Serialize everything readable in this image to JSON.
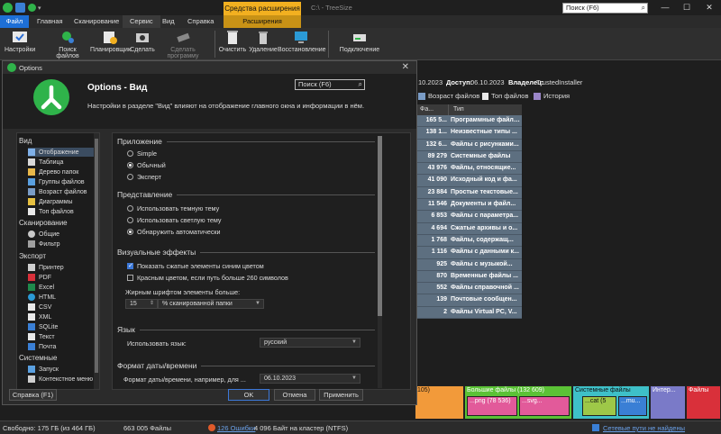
{
  "titlebar": {
    "context_tab": "Средства расширения",
    "title": "C:\\ - TreeSize",
    "search_placeholder": "Поиск (F6)",
    "minimize": "—",
    "maximize": "☐",
    "close": "✕"
  },
  "ribbon_tabs": [
    "Файл",
    "Главная",
    "Сканирование",
    "Сервис",
    "Вид",
    "Справка",
    "Расширения"
  ],
  "ribbon_buttons": [
    "Настройки",
    "Поиск файлов",
    "Планировщик",
    "Сделать",
    "Сделать программу",
    "Очистить",
    "Удаление",
    "Восстановление",
    "Подключение"
  ],
  "info": {
    "date": "10.2023",
    "access_label": "Доступ:",
    "access_value": "06.10.2023",
    "owner_label": "Владелец:",
    "owner_value": "TrustedInstaller"
  },
  "subtools": [
    "Возраст файлов",
    "Топ файлов",
    "История"
  ],
  "filetable": {
    "headers": [
      "Фа...",
      "Тип"
    ],
    "rows": [
      [
        "165 5...",
        "Программные файлы..."
      ],
      [
        "138 1...",
        "Неизвестные типы ..."
      ],
      [
        "132 6...",
        "Файлы с рисунками..."
      ],
      [
        "89 279",
        "Системные файлы"
      ],
      [
        "43 976",
        "Файлы, относящие..."
      ],
      [
        "41 090",
        "Исходный код и фа..."
      ],
      [
        "23 884",
        "Простые текстовые..."
      ],
      [
        "11 546",
        "Документы и файл..."
      ],
      [
        "6 853",
        "Файлы с параметра..."
      ],
      [
        "4 694",
        "Сжатые архивы и о..."
      ],
      [
        "1 768",
        "Файлы, содержащ..."
      ],
      [
        "1 116",
        "Файлы с данными к..."
      ],
      [
        "925",
        "Файлы с музыкой..."
      ],
      [
        "870",
        "Временные файлы ..."
      ],
      [
        "552",
        "Файлы справочной ..."
      ],
      [
        "139",
        "Почтовые сообщен..."
      ],
      [
        "2",
        "Файлы Virtual PC, V..."
      ]
    ]
  },
  "treemap": {
    "t1": "105)",
    "t2": "Большие файлы (132 609)",
    "t3": "...png (78 536)",
    "t4": "...svg...",
    "t5": "Системные файлы",
    "t6": "...cat (5",
    "t7": "...mu...",
    "t8": "Интер...",
    "t9": "Файлы"
  },
  "statusbar": {
    "free": "Свободно: 175 ГБ (из 464 ГБ)",
    "files": "663 005 Файлы",
    "errors": "126 Ошибки",
    "cluster": "4 096 Байт на кластер (NTFS)",
    "network": "Сетевые пути не найдены"
  },
  "dialog": {
    "title": "Options",
    "close": "✕",
    "heading": "Options - Вид",
    "description": "Настройки в разделе \"Вид\" влияют на отображение главного окна и информации в нём.",
    "search_placeholder": "Поиск (F6)",
    "nav": {
      "sec_view": "Вид",
      "sec_scan": "Сканирование",
      "sec_export": "Экспорт",
      "sec_system": "Системные",
      "items_view": [
        "Отображение",
        "Таблица",
        "Дерево папок",
        "Группы файлов",
        "Возраст файлов",
        "Диаграммы",
        "Топ файлов"
      ],
      "items_scan": [
        "Общие",
        "Фильтр"
      ],
      "items_export": [
        "Принтер",
        "PDF",
        "Excel",
        "HTML",
        "CSV",
        "XML",
        "SQLite",
        "Текст",
        "Почта"
      ],
      "items_system": [
        "Запуск",
        "Контекстное меню"
      ]
    },
    "app_group": "Приложение",
    "app_opts": [
      "Simple",
      "Обычный",
      "Эксперт"
    ],
    "theme_group": "Представление",
    "theme_opts": [
      "Использовать темную тему",
      "Использовать светлую тему",
      "Обнаружить автоматически"
    ],
    "visual_group": "Визуальные эффекты",
    "visual_chk1": "Показать сжатые элементы синим цветом",
    "visual_chk2": "Красным цветом, если путь больше 260 символов",
    "bold_label": "Жирным шрифтом элементы больше:",
    "bold_value": "15",
    "bold_unit": "% сканированной папки",
    "lang_group": "Язык",
    "lang_label": "Использовать язык:",
    "lang_value": "русский",
    "date_group": "Формат даты/времени",
    "date_label": "Формат даты/времени, например, для ...",
    "date_value": "06.10.2023",
    "btn_help": "Справка (F1)",
    "btn_ok": "OK",
    "btn_cancel": "Отмена",
    "btn_apply": "Применить"
  },
  "colors": {
    "accent_blue": "#1d6fd6",
    "context_orange": "#f2b020",
    "treesize_green": "#2fb34a",
    "table_row": "#5d6f80"
  }
}
